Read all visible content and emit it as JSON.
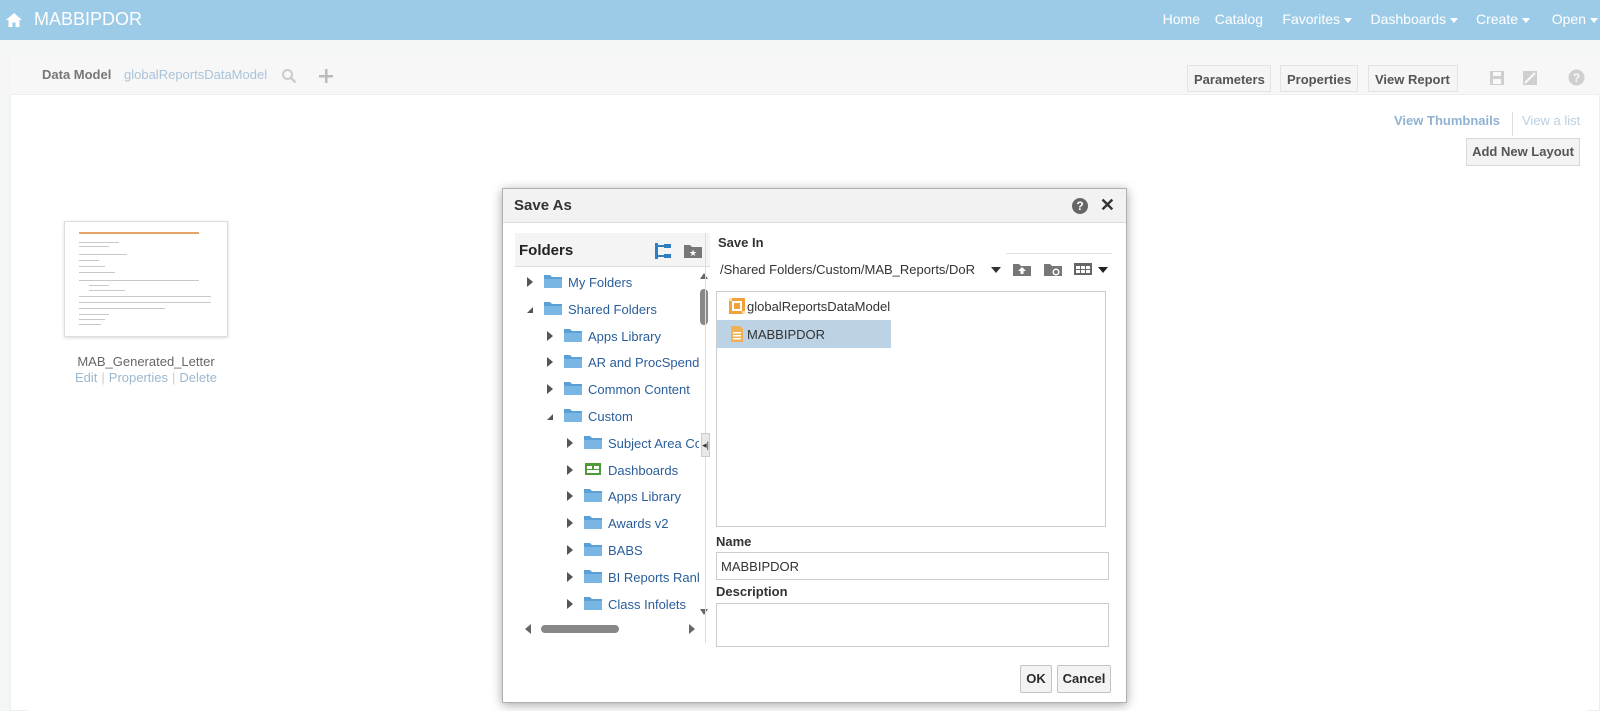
{
  "app": {
    "title": "MABBIPDOR"
  },
  "topnav": {
    "home": "Home",
    "catalog": "Catalog",
    "favorites": "Favorites",
    "dashboards": "Dashboards",
    "create": "Create",
    "open": "Open"
  },
  "toolbar": {
    "data_model_label": "Data Model",
    "data_model_value": "globalReportsDataModel",
    "parameters": "Parameters",
    "properties": "Properties",
    "view_report": "View Report"
  },
  "view": {
    "thumbnails": "View Thumbnails",
    "list": "View a list",
    "add_layout": "Add New Layout"
  },
  "layout_card": {
    "title": "MAB_Generated_Letter",
    "edit": "Edit",
    "properties": "Properties",
    "delete": "Delete"
  },
  "dialog": {
    "title": "Save As",
    "folders_title": "Folders",
    "tree": [
      {
        "label": "My Folders",
        "level": 0,
        "state": "collapsed",
        "icon": "folder-icon"
      },
      {
        "label": "Shared Folders",
        "level": 0,
        "state": "expanded",
        "icon": "folder-icon"
      },
      {
        "label": "Apps Library",
        "level": 1,
        "state": "collapsed",
        "icon": "folder-icon"
      },
      {
        "label": "AR and ProcSpend",
        "level": 1,
        "state": "collapsed",
        "icon": "folder-icon"
      },
      {
        "label": "Common Content",
        "level": 1,
        "state": "collapsed",
        "icon": "folder-icon"
      },
      {
        "label": "Custom",
        "level": 1,
        "state": "expanded",
        "icon": "folder-icon"
      },
      {
        "label": "Subject Area Contents",
        "level": 2,
        "state": "collapsed",
        "icon": "folder-icon"
      },
      {
        "label": "Dashboards",
        "level": 2,
        "state": "collapsed",
        "icon": "dashboard-icon"
      },
      {
        "label": "Apps Library",
        "level": 2,
        "state": "collapsed",
        "icon": "folder-icon"
      },
      {
        "label": "Awards v2",
        "level": 2,
        "state": "collapsed",
        "icon": "folder-icon"
      },
      {
        "label": "BABS",
        "level": 2,
        "state": "collapsed",
        "icon": "folder-icon"
      },
      {
        "label": "BI Reports Ranking",
        "level": 2,
        "state": "collapsed",
        "icon": "folder-icon"
      },
      {
        "label": "Class Infolets",
        "level": 2,
        "state": "collapsed",
        "icon": "folder-icon"
      }
    ],
    "save_in_label": "Save In",
    "save_in_path": "/Shared Folders/Custom/MAB_Reports/DoR",
    "files": [
      {
        "name": "globalReportsDataModel",
        "icon": "data-model-icon",
        "selected": false
      },
      {
        "name": "MABBIPDOR",
        "icon": "report-icon",
        "selected": true
      }
    ],
    "name_label": "Name",
    "name_value": "MABBIPDOR",
    "description_label": "Description",
    "description_value": "",
    "ok": "OK",
    "cancel": "Cancel"
  }
}
